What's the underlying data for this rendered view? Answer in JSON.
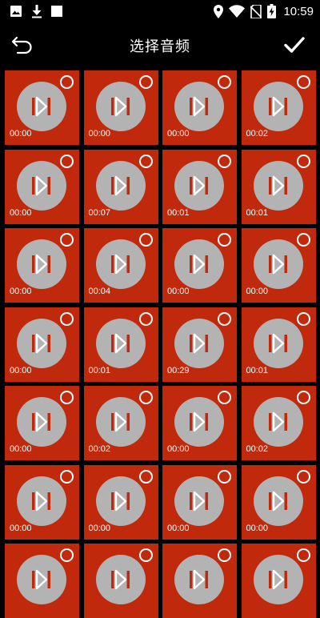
{
  "status_bar": {
    "time": "10:59",
    "left_icons": [
      "image-icon",
      "download-icon",
      "square-icon"
    ],
    "right_icons": [
      "location-icon",
      "wifi-icon",
      "no-sim-icon",
      "battery-charging-icon"
    ]
  },
  "app_bar": {
    "title": "选择音频",
    "back_icon": "back-icon",
    "confirm_icon": "check-icon"
  },
  "colors": {
    "tile_bg": "#c0290b",
    "disc": "#b3b3b3",
    "icon_white": "#ffffff",
    "background": "#000000"
  },
  "audio_items": [
    {
      "duration": "00:00"
    },
    {
      "duration": "00:00"
    },
    {
      "duration": "00:00"
    },
    {
      "duration": "00:02"
    },
    {
      "duration": "00:00"
    },
    {
      "duration": "00:07"
    },
    {
      "duration": "00:01"
    },
    {
      "duration": "00:01"
    },
    {
      "duration": "00:00"
    },
    {
      "duration": "00:04"
    },
    {
      "duration": "00:00"
    },
    {
      "duration": "00:00"
    },
    {
      "duration": "00:00"
    },
    {
      "duration": "00:01"
    },
    {
      "duration": "00:29"
    },
    {
      "duration": "00:01"
    },
    {
      "duration": "00:00"
    },
    {
      "duration": "00:02"
    },
    {
      "duration": "00:00"
    },
    {
      "duration": "00:02"
    },
    {
      "duration": "00:00"
    },
    {
      "duration": "00:00"
    },
    {
      "duration": "00:00"
    },
    {
      "duration": "00:00"
    },
    {
      "duration": ""
    },
    {
      "duration": ""
    },
    {
      "duration": ""
    },
    {
      "duration": ""
    }
  ]
}
